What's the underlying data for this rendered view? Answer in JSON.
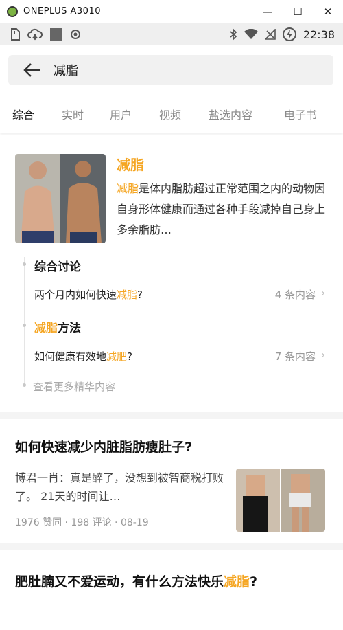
{
  "window": {
    "title": "ONEPLUS A3010",
    "minimize_glyph": "—",
    "maximize_glyph": "☐",
    "close_glyph": "✕"
  },
  "statusbar": {
    "time": "22:38",
    "left_icons": [
      "sd-card-icon",
      "cloud-download-icon",
      "app-square-icon",
      "record-icon"
    ],
    "right_icons": [
      "bluetooth-icon",
      "wifi-icon",
      "no-signal-icon",
      "battery-charging-icon"
    ]
  },
  "search": {
    "query": "减脂"
  },
  "tabs": [
    {
      "label": "综合",
      "active": true
    },
    {
      "label": "实时",
      "active": false
    },
    {
      "label": "用户",
      "active": false
    },
    {
      "label": "视频",
      "active": false
    },
    {
      "label": "盐选内容",
      "active": false
    },
    {
      "label": "电子书",
      "active": false
    }
  ],
  "wiki": {
    "title": "减脂",
    "desc_highlight": "减脂",
    "desc_rest": "是体内脂肪超过正常范围之内的动物因自身形体健康而通过各种手段减掉自己身上多余脂肪…",
    "section1": {
      "heading": "综合讨论",
      "row_text": "两个月内如何快速",
      "row_highlight": "减脂",
      "row_suffix": "?",
      "count": "4 条内容"
    },
    "section2": {
      "heading_highlight": "减脂",
      "heading_rest": "方法",
      "row_text": "如何健康有效地",
      "row_highlight": "减肥",
      "row_suffix": "?",
      "count": "7 条内容"
    },
    "more": "查看更多精华内容"
  },
  "article1": {
    "title": "如何快速减少内脏脂肪瘦肚子?",
    "summary": "博君一肖：真是醉了，没想到被智商税打败了。 21天的时间让…",
    "meta": "1976 赞同 · 198 评论 · 08-19"
  },
  "article2": {
    "title_main": "肥肚腩又不爱运动，有什么方法快乐",
    "title_highlight": "减脂",
    "title_suffix": "?"
  },
  "colors": {
    "accent": "#f5a623",
    "muted": "#999999"
  }
}
